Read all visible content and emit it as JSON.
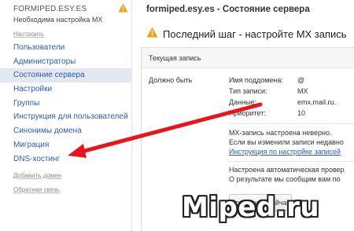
{
  "sidebar": {
    "domain_name": "FORMIPED.ESY.ES",
    "domain_status": "Необходима настройка MX",
    "setup_link": "Настроить",
    "items": [
      {
        "label": "Пользователи"
      },
      {
        "label": "Администраторы"
      },
      {
        "label": "Состояние сервера",
        "active": true
      },
      {
        "label": "Настройки"
      },
      {
        "label": "Группы"
      },
      {
        "label": "Инструкция для пользователей"
      },
      {
        "label": "Синонимы домена"
      },
      {
        "label": "Миграция"
      },
      {
        "label": "DNS-хостинг"
      }
    ],
    "add_domain": "Добавить домен",
    "feedback": "Обратная связь"
  },
  "main": {
    "title": "formiped.esy.es - Состояние сервера",
    "alert": "Последний шаг - настройте MX запись",
    "panel": {
      "current_record": "Текущая запись",
      "should_be": "Должно быть",
      "records": [
        {
          "label": "Имя поддомена:",
          "value": "@"
        },
        {
          "label": "Тип записи:",
          "value": "MX"
        },
        {
          "label": "Данные:",
          "value": "emx.mail.ru."
        },
        {
          "label": "Приоритет:",
          "value": "10"
        }
      ],
      "mx_wrong": "MX-запись настроена неверно.",
      "if_changed": "Если вы изменили записи недавно",
      "instruction_link": "Инструкция по настройке записей",
      "auto_check": "Настроена автоматическая провер",
      "result_notify": "О результате мы сообщим вам по",
      "check_button": "Проверить сейчас"
    }
  },
  "watermark": "Miped.ru",
  "colors": {
    "warning": "#f0a30a",
    "arrow": "#e8161b",
    "link": "#2a5db0",
    "active_bg": "#e3e8f0"
  }
}
